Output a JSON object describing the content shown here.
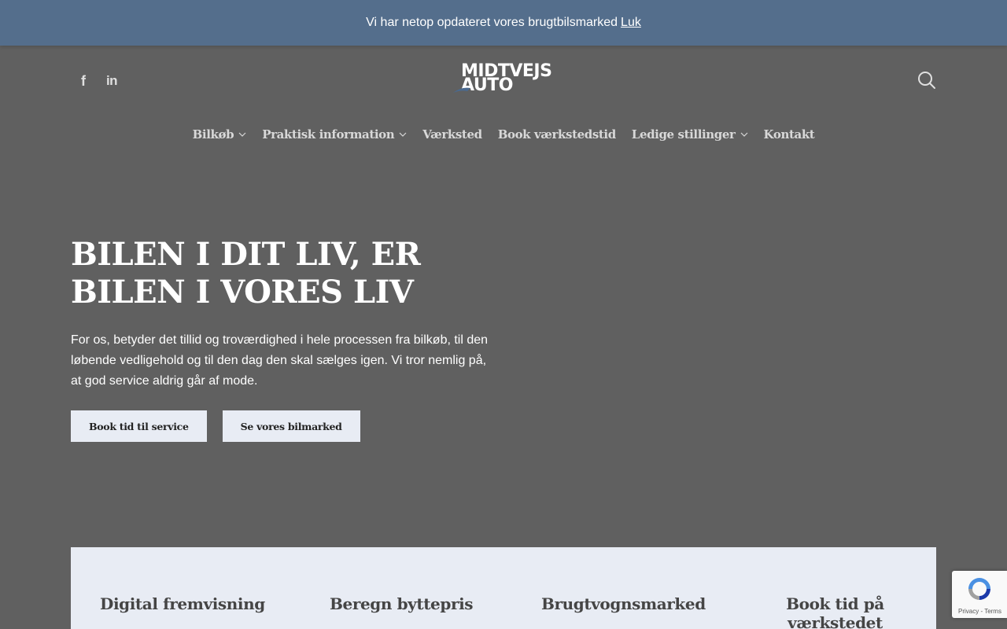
{
  "announcement": {
    "text": "Vi har netop opdateret vores brugtbilsmarked",
    "close_label": "Luk"
  },
  "social": {
    "facebook": "f",
    "linkedin": "in"
  },
  "logo": {
    "line1": "MIDTVEJS",
    "line2": "AUTO"
  },
  "nav": {
    "items": [
      {
        "label": "Bilkøb",
        "dropdown": true
      },
      {
        "label": "Praktisk information",
        "dropdown": true
      },
      {
        "label": "Værksted",
        "dropdown": false
      },
      {
        "label": "Book værkstedstid",
        "dropdown": false
      },
      {
        "label": "Ledige stillinger",
        "dropdown": true
      },
      {
        "label": "Kontakt",
        "dropdown": false
      }
    ]
  },
  "hero": {
    "title": "BILEN I DIT LIV, ER BILEN I VORES LIV",
    "body": "For os, betyder det tillid og troværdighed i hele processen fra bilkøb, til den løbende vedligehold og til den dag den skal sælges igen. Vi tror nemlig på, at god service aldrig går af mode.",
    "button_primary": "Book tid til service",
    "button_secondary": "Se vores bilmarked"
  },
  "panel": {
    "col1": "Digital fremvisning",
    "col2": "Beregn byttepris",
    "col3": "Brugtvognsmarked",
    "col4": "Book tid på værkstedet"
  },
  "recaptcha": {
    "links": "Privacy - Terms"
  },
  "colors": {
    "background": "#606060",
    "announcement": "#546e8c",
    "panel": "#e8ecf4"
  }
}
